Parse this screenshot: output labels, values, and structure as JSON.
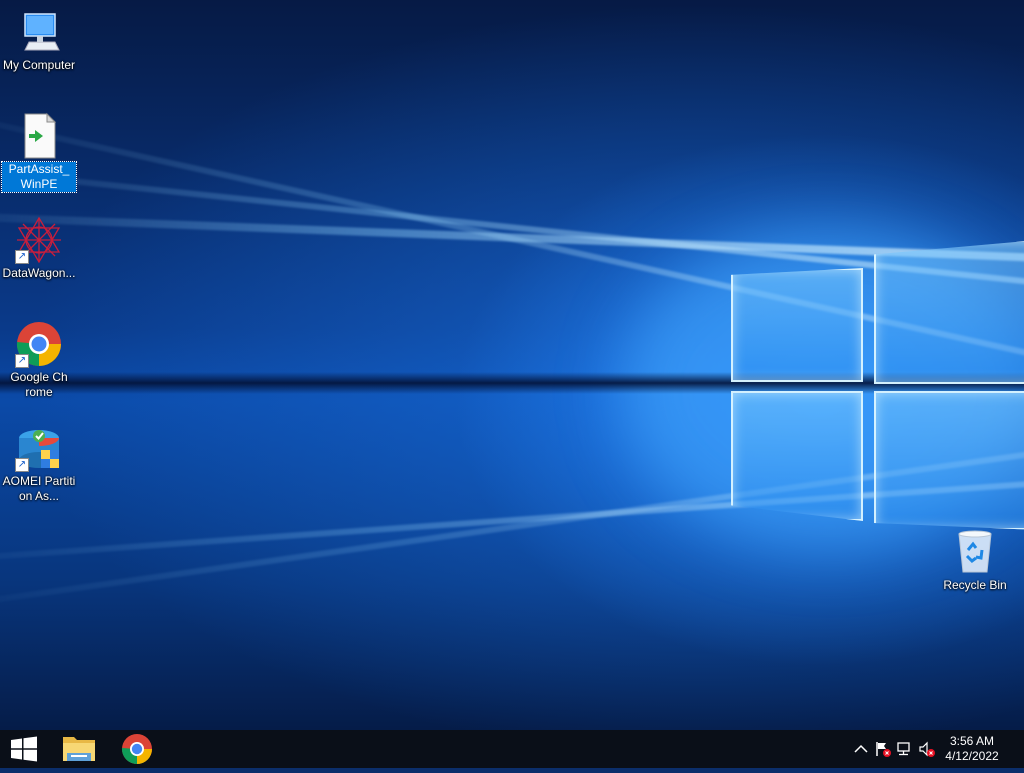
{
  "desktop": {
    "icons": [
      {
        "name": "my-computer",
        "label": "My Computer",
        "selected": false
      },
      {
        "name": "partassist-winpe",
        "label": "PartAssist_WinPE",
        "selected": true
      },
      {
        "name": "datawagon",
        "label": "DataWagon...",
        "selected": false
      },
      {
        "name": "google-chrome",
        "label": "Google Chrome",
        "selected": false
      },
      {
        "name": "aomei-partition",
        "label": "AOMEI Partition As...",
        "selected": false
      },
      {
        "name": "recycle-bin",
        "label": "Recycle Bin",
        "selected": false
      }
    ]
  },
  "taskbar": {
    "pinned": [
      {
        "name": "start",
        "icon": "windows-logo-icon"
      },
      {
        "name": "file-explorer",
        "icon": "folder-icon"
      },
      {
        "name": "chrome",
        "icon": "chrome-icon"
      }
    ],
    "tray_icons": [
      "chevron-up-icon",
      "action-center-flag-icon",
      "network-icon",
      "volume-muted-icon"
    ],
    "clock": {
      "time": "3:56 AM",
      "date": "4/12/2022"
    }
  },
  "colors": {
    "taskbar": "#0a0f18",
    "selection": "#0078d7",
    "wallpaper_accent": "#1e8cff"
  }
}
